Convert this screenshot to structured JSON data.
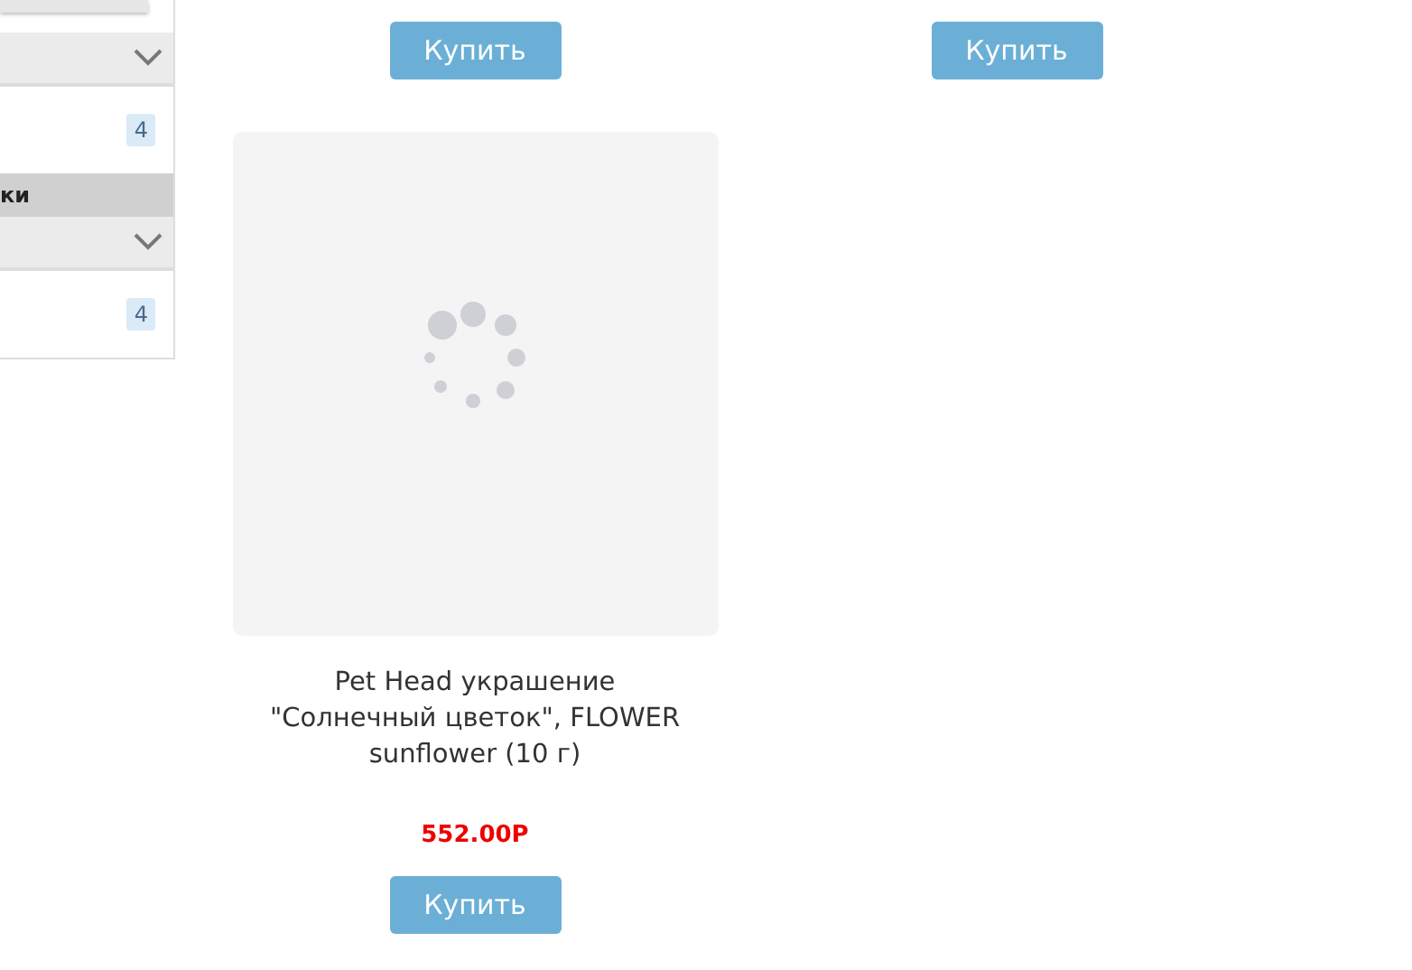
{
  "sidebar": {
    "sections": [
      {
        "kind": "bar"
      },
      {
        "kind": "dropdown"
      },
      {
        "kind": "item",
        "badge": "4"
      },
      {
        "kind": "header",
        "label": "ки"
      },
      {
        "kind": "dropdown"
      },
      {
        "kind": "item",
        "badge": "4"
      }
    ]
  },
  "products": [
    {
      "kind": "cut",
      "button": "Купить"
    },
    {
      "kind": "cut",
      "button": "Купить"
    },
    {
      "kind": "card",
      "loading": true,
      "title": "Pet Head украшение \"Солнечный цветок\", FLOWER sunflower (10 г)",
      "price": "552.00Р",
      "button": "Купить"
    }
  ]
}
